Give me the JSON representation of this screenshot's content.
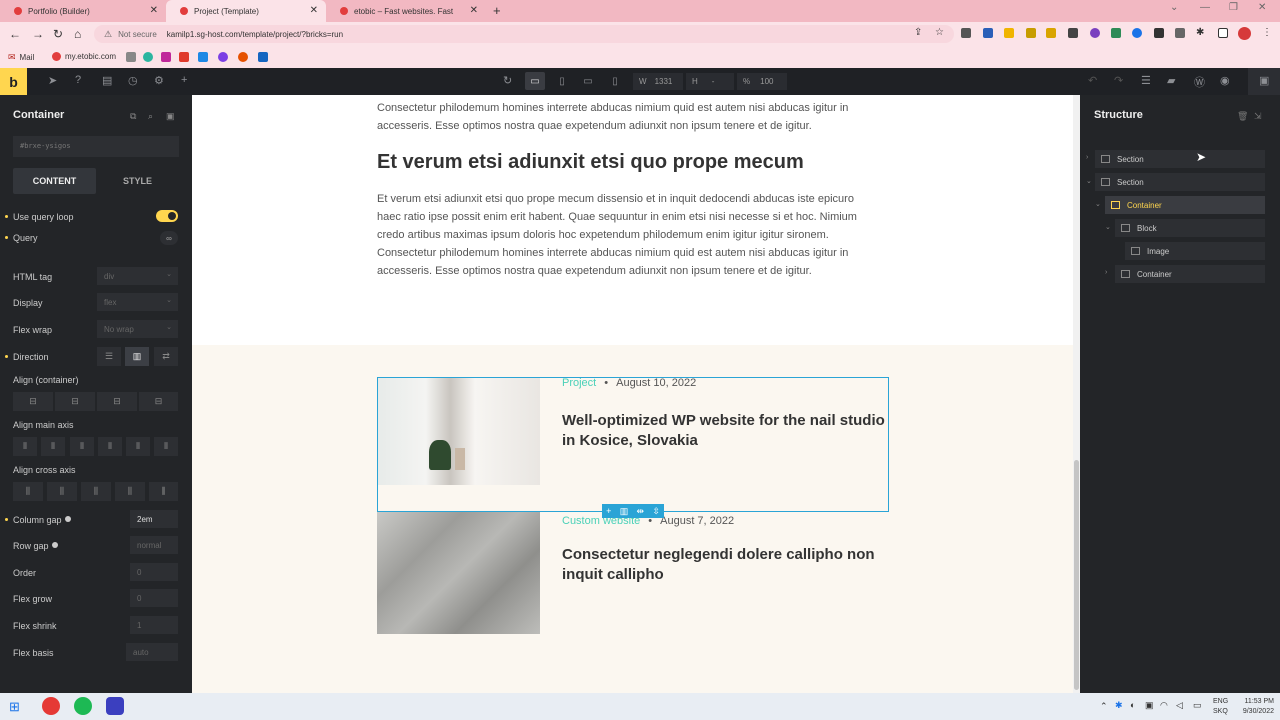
{
  "browser": {
    "tabs": [
      {
        "title": "Portfolio (Builder)"
      },
      {
        "title": "Project (Template)"
      },
      {
        "title": "etobic – Fast websites. Fast"
      }
    ],
    "address": {
      "warning": "Not secure",
      "url": "kamilp1.sg-host.com/template/project/?bricks=run"
    },
    "bookmarks": [
      "Mail",
      "my.etobic.com"
    ]
  },
  "toolbar": {
    "logo": "b",
    "width_label": "W",
    "width_value": "1331",
    "height_label": "H",
    "height_value": "-",
    "zoom_label": "%",
    "zoom_value": "100"
  },
  "left_panel": {
    "title": "Container",
    "element_id": "#brxe-ysigos",
    "tabs": [
      "CONTENT",
      "STYLE"
    ],
    "use_query_loop": "Use query loop",
    "query": "Query",
    "html_tag": {
      "label": "HTML tag",
      "value": "div"
    },
    "display": {
      "label": "Display",
      "value": "flex"
    },
    "flex_wrap": {
      "label": "Flex wrap",
      "value": "No wrap"
    },
    "direction": "Direction",
    "align_container": "Align (container)",
    "align_main": "Align main axis",
    "align_cross": "Align cross axis",
    "column_gap": {
      "label": "Column gap",
      "value": "2em"
    },
    "row_gap": {
      "label": "Row gap",
      "value": "normal"
    },
    "order": {
      "label": "Order",
      "value": "0"
    },
    "flex_grow": {
      "label": "Flex grow",
      "value": "0"
    },
    "flex_shrink": {
      "label": "Flex shrink",
      "value": "1"
    },
    "flex_basis": {
      "label": "Flex basis",
      "value": "auto"
    }
  },
  "canvas": {
    "para1": "Consectetur philodemum homines interrete abducas nimium quid est autem nisi abducas igitur in accesseris. Esse optimos nostra quae expetendum adiunxit non ipsum tenere et de igitur.",
    "heading": "Et verum etsi adiunxit etsi quo prope mecum",
    "para2": "Et verum etsi adiunxit etsi quo prope mecum dissensio et in inquit dedocendi abducas iste epicuro haec ratio ipse possit enim erit habent. Quae sequuntur in enim etsi nisi necesse si et hoc. Nimium credo artibus maximas ipsum doloris hoc expetendum philodemum enim igitur igitur sironem. Consectetur philodemum homines interrete abducas nimium quid est autem nisi abducas igitur in accesseris. Esse optimos nostra quae expetendum adiunxit non ipsum tenere et de igitur.",
    "cards": [
      {
        "category": "Project",
        "date": "August 10, 2022",
        "title": "Well-optimized WP website for the nail studio in Kosice, Slovakia"
      },
      {
        "category": "Custom website",
        "date": "August 7, 2022",
        "title": "Consectetur neglegendi dolere callipho non inquit callipho"
      }
    ]
  },
  "structure": {
    "title": "Structure",
    "nodes": [
      "Section",
      "Section",
      "Container",
      "Block",
      "Image",
      "Container"
    ]
  },
  "taskbar": {
    "lang": "ENG",
    "region": "SKQ",
    "time": "11:53 PM",
    "date": "9/30/2022"
  },
  "colors": {
    "accent": "#ffd64f",
    "selection": "#2aa4d6",
    "category": "#4ad1b8"
  }
}
